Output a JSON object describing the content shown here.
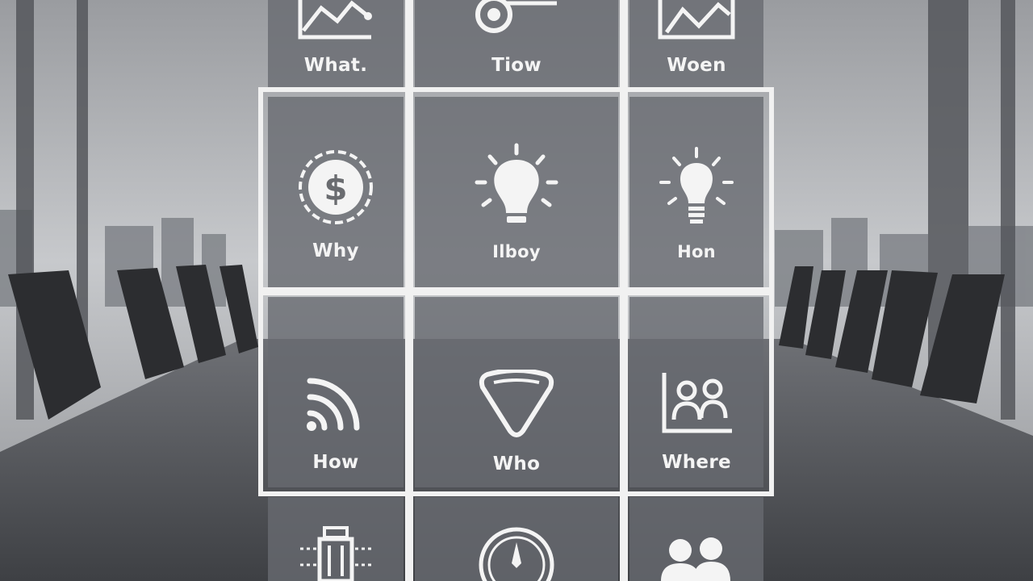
{
  "grid": {
    "rows": [
      {
        "tiles": [
          {
            "label": "What.",
            "icon": "line-chart-icon"
          },
          {
            "label": "Tiow",
            "icon": "key-icon"
          },
          {
            "label": "Woen",
            "icon": "area-chart-icon"
          }
        ]
      },
      {
        "tiles": [
          {
            "label": "Why",
            "icon": "dollar-gear-icon"
          },
          {
            "label": "Ilboy",
            "icon": "lightbulb-icon"
          },
          {
            "label": "Hon",
            "icon": "idea-bulb-icon"
          }
        ]
      },
      {
        "tiles": [
          {
            "label": "How",
            "icon": "signal-icon"
          },
          {
            "label": "Who",
            "icon": "shield-icon"
          },
          {
            "label": "Where",
            "icon": "people-chart-icon"
          }
        ]
      },
      {
        "tiles": [
          {
            "label": "",
            "icon": "server-icon"
          },
          {
            "label": "",
            "icon": "compass-icon"
          },
          {
            "label": "",
            "icon": "team-icon"
          }
        ]
      }
    ]
  },
  "colors": {
    "line": "#f1f1f1",
    "tile": "#6a6c70"
  }
}
